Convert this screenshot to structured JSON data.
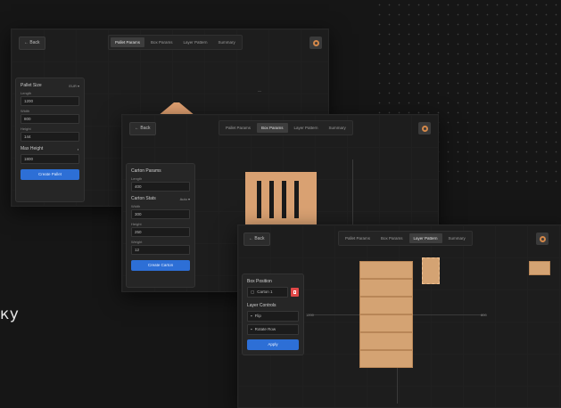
{
  "side_text": "ку",
  "window1": {
    "back_label": "← Back",
    "tabs": [
      "Pallet Params",
      "Box Params",
      "Layer Pattern",
      "Summary"
    ],
    "active_tab": 0,
    "panel": {
      "title": "Pallet Size",
      "badge": "EUR ▾",
      "fields": [
        {
          "label": "Length",
          "value": "1200"
        },
        {
          "label": "Width",
          "value": "800"
        },
        {
          "label": "Height",
          "value": "144"
        }
      ],
      "row_label": "Max Height",
      "row_value": "1800",
      "button": "Create Pallet"
    }
  },
  "window2": {
    "back_label": "← Back",
    "tabs": [
      "Pallet Params",
      "Box Params",
      "Layer Pattern",
      "Summary"
    ],
    "active_tab": 1,
    "panel": {
      "title": "Carton Params",
      "fields": [
        {
          "label": "Length",
          "value": "400"
        },
        {
          "label": "Width",
          "value": "300"
        },
        {
          "label": "Height",
          "value": "250"
        }
      ],
      "section": "Carton Stats",
      "section_badge": "Auto ▾",
      "extra_field": {
        "label": "Weight",
        "value": "12"
      },
      "button": "Create Carton"
    }
  },
  "window3": {
    "back_label": "← Back",
    "tabs": [
      "Pallet Params",
      "Box Params",
      "Layer Pattern",
      "Summary"
    ],
    "active_tab": 2,
    "measure_right": "800",
    "measure_left": "1200",
    "panel": {
      "title": "Box Position",
      "box_label": "Carton 1",
      "section": "Layer Controls",
      "options": [
        "Flip",
        "Rotate Row"
      ],
      "button": "Apply"
    }
  },
  "colors": {
    "accent": "#d4884a",
    "box": "#d4a373",
    "button": "#2d6fd6",
    "danger": "#e04848"
  }
}
